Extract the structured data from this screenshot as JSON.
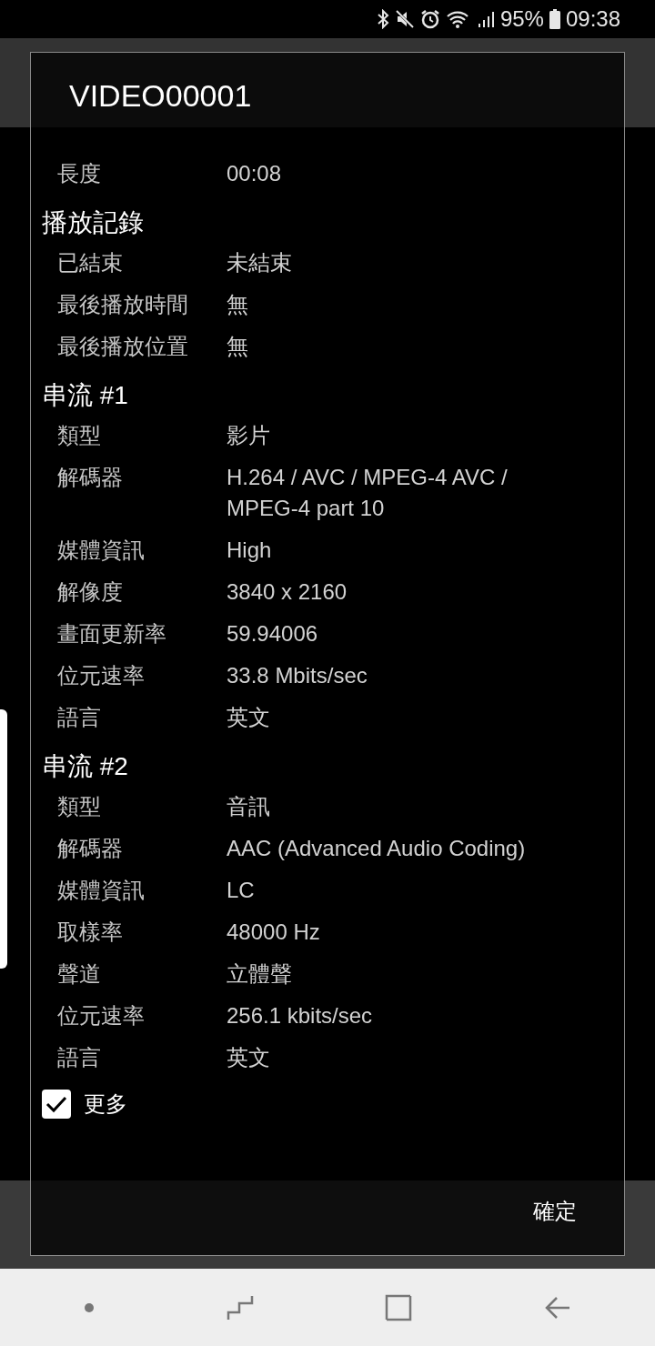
{
  "status_bar": {
    "battery": "95%",
    "time": "09:38"
  },
  "dialog": {
    "title": "VIDEO00001",
    "items": [
      {
        "kind": "row",
        "label": "長度",
        "value": "00:08"
      },
      {
        "kind": "heading",
        "text": "播放記錄"
      },
      {
        "kind": "row",
        "label": "已結束",
        "value": "未結束"
      },
      {
        "kind": "row",
        "label": "最後播放時間",
        "value": "無"
      },
      {
        "kind": "row",
        "label": "最後播放位置",
        "value": "無"
      },
      {
        "kind": "heading",
        "text": "串流 #1"
      },
      {
        "kind": "row",
        "label": "類型",
        "value": "影片"
      },
      {
        "kind": "row",
        "label": "解碼器",
        "value": "H.264 / AVC / MPEG‑4 AVC / MPEG‑4 part 10"
      },
      {
        "kind": "row",
        "label": "媒體資訊",
        "value": "High"
      },
      {
        "kind": "row",
        "label": "解像度",
        "value": "3840 x 2160"
      },
      {
        "kind": "row",
        "label": "畫面更新率",
        "value": "59.94006"
      },
      {
        "kind": "row",
        "label": "位元速率",
        "value": "33.8 Mbits/sec"
      },
      {
        "kind": "row",
        "label": "語言",
        "value": "英文"
      },
      {
        "kind": "heading",
        "text": "串流 #2"
      },
      {
        "kind": "row",
        "label": "類型",
        "value": "音訊"
      },
      {
        "kind": "row",
        "label": "解碼器",
        "value": "AAC (Advanced Audio Coding)"
      },
      {
        "kind": "row",
        "label": "媒體資訊",
        "value": "LC"
      },
      {
        "kind": "row",
        "label": "取樣率",
        "value": "48000 Hz"
      },
      {
        "kind": "row",
        "label": "聲道",
        "value": "立體聲"
      },
      {
        "kind": "row",
        "label": "位元速率",
        "value": "256.1 kbits/sec"
      },
      {
        "kind": "row",
        "label": "語言",
        "value": "英文"
      }
    ],
    "more": {
      "label": "更多",
      "checked": true
    },
    "ok_button": "確定"
  }
}
